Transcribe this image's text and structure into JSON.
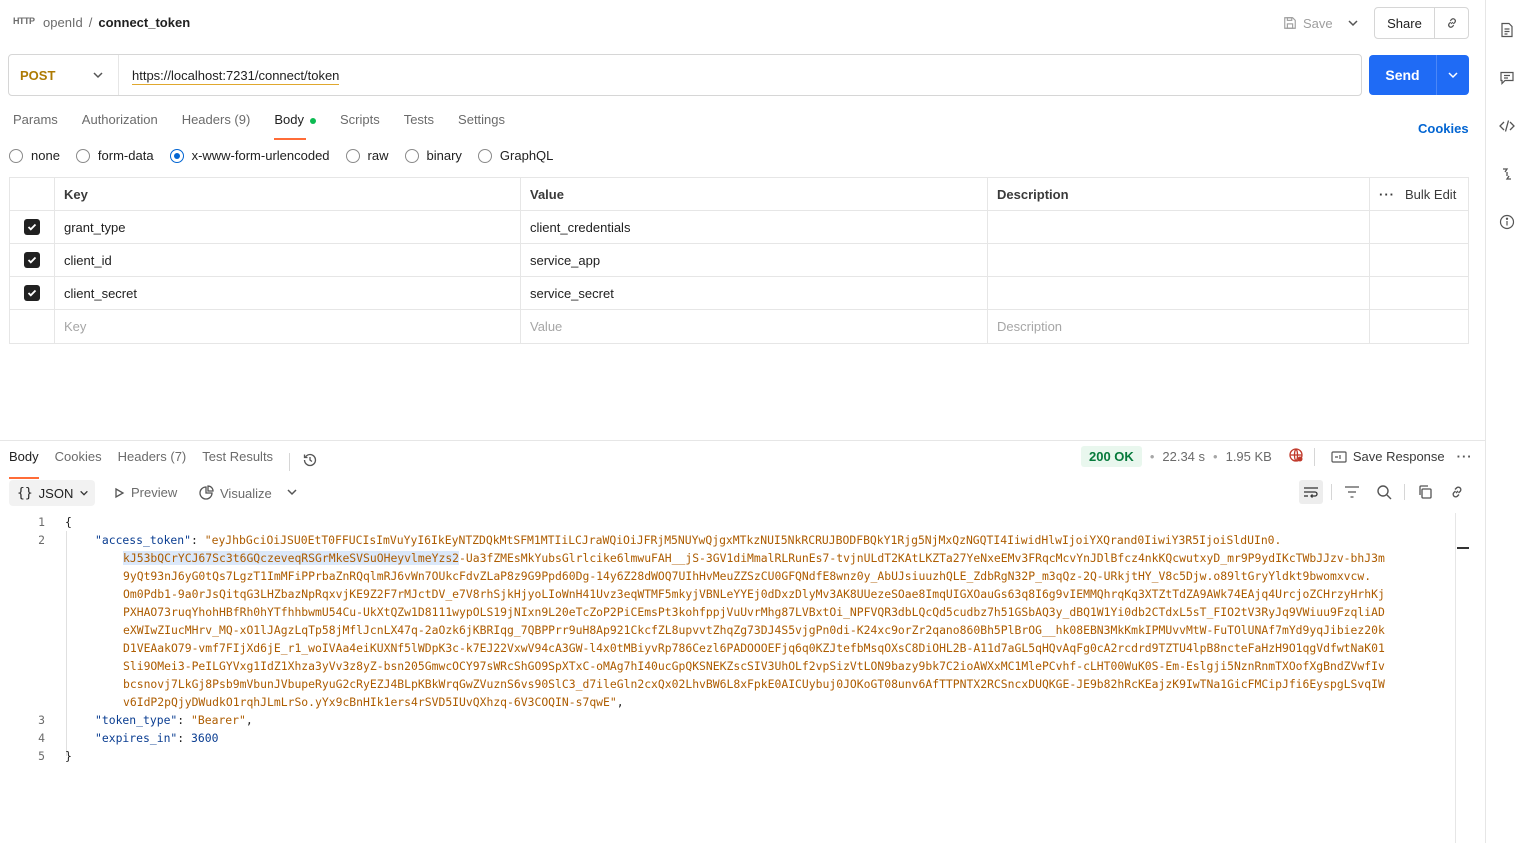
{
  "header": {
    "http_label": "HTTP",
    "crumb_parent": "openId",
    "crumb_sep": "/",
    "crumb_current": "connect_token",
    "save_label": "Save",
    "share_label": "Share"
  },
  "request": {
    "method": "POST",
    "url": "https://localhost:7231/connect/token",
    "send_label": "Send",
    "tabs": [
      {
        "label": "Params"
      },
      {
        "label": "Authorization"
      },
      {
        "label": "Headers (9)"
      },
      {
        "label": "Body"
      },
      {
        "label": "Scripts"
      },
      {
        "label": "Tests"
      },
      {
        "label": "Settings"
      }
    ],
    "cookies_label": "Cookies",
    "body_types": [
      {
        "label": "none",
        "selected": false
      },
      {
        "label": "form-data",
        "selected": false
      },
      {
        "label": "x-www-form-urlencoded",
        "selected": true
      },
      {
        "label": "raw",
        "selected": false
      },
      {
        "label": "binary",
        "selected": false
      },
      {
        "label": "GraphQL",
        "selected": false
      }
    ],
    "table": {
      "headers": {
        "key": "Key",
        "value": "Value",
        "description": "Description",
        "bulk_edit": "Bulk Edit"
      },
      "rows": [
        {
          "key": "grant_type",
          "value": "client_credentials",
          "checked": true
        },
        {
          "key": "client_id",
          "value": "service_app",
          "checked": true
        },
        {
          "key": "client_secret",
          "value": "service_secret",
          "checked": true
        }
      ],
      "placeholders": {
        "key": "Key",
        "value": "Value",
        "description": "Description"
      }
    }
  },
  "response": {
    "tabs": [
      {
        "label": "Body"
      },
      {
        "label": "Cookies"
      },
      {
        "label": "Headers (7)"
      },
      {
        "label": "Test Results"
      }
    ],
    "status": "200 OK",
    "time": "22.34 s",
    "size": "1.95 KB",
    "save_response_label": "Save Response",
    "format_label": "JSON",
    "preview_label": "Preview",
    "visualize_label": "Visualize",
    "code": {
      "line_numbers": [
        "1",
        "2",
        "3",
        "4",
        "5"
      ],
      "open_brace": "{",
      "close_brace": "}",
      "access_token_key": "\"access_token\"",
      "token_line_1": "\"eyJhbGciOiJSU0EtT0FFUCIsImVuYyI6IkEyNTZDQkMtSFM1MTIiLCJraWQiOiJFRjM5NUYwQjgxMTkzNUI5NkRCRUJBODFBQkY1Rjg5NjMxQzNGQTI4IiwidHlwIjoiYXQrand0IiwiY3R5IjoiSldUIn0.",
      "token_line_2_hl": "kJ53bQCrYCJ67Sc3t6GQczeveqRSGrMkeSVSuOHeyvlmeYzs2",
      "token_line_2_rest": "-Ua3fZMEsMkYubsGlrlcike6lmwuFAH__jS-3GV1diMmalRLRunEs7-tvjnULdT2KAtLKZTa27YeNxeEMv3FRqcMcvYnJDlBfcz4nkKQcwutxyD_mr9P9ydIKcTWbJJzv-bhJ3m",
      "token_line_3": "9yQt93nJ6yG0tQs7LgzT1ImMFiPPrbaZnRQqlmRJ6vWn7OUkcFdvZLaP8z9G9Ppd60Dg-14y6Z28dWOQ7UIhHvMeuZZSzCU0GFQNdfE8wnz0y_AbUJsiuuzhQLE_ZdbRgN32P_m3qQz-2Q-URkjtHY_V8c5Djw.o89ltGryYldkt9bwomxvcw.",
      "token_line_4": "Om0Pdb1-9a0rJsQitqG3LHZbazNpRqxvjKE9Z2F7rMJctDV_e7V8rhSjkHjyoLIoWnH41Uvz3eqWTMF5mkyjVBNLeYYEj0dDxzDlyMv3AK8UUezeSOae8ImqUIGXOauGs63q8I6g9vIEMMQhrqKq3XTZtTdZA9AWk74EAjq4UrcjoZCHrzyHrhKj",
      "token_line_5": "PXHAO73ruqYhohHBfRh0hYTfhhbwmU54Cu-UkXtQZw1D8111wypOLS19jNIxn9L20eTcZoP2PiCEmsPt3kohfppjVuUvrMhg87LVBxtOi_NPFVQR3dbLQcQd5cudbz7h51GSbAQ3y_dBQ1W1Yi0db2CTdxL5sT_FIO2tV3RyJq9VWiuu9FzqliAD",
      "token_line_6": "eXWIwZIucMHrv_MQ-xO1lJAgzLqTp58jMflJcnLX47q-2aOzk6jKBRIqg_7QBPPrr9uH8Ap921CkcfZL8upvvtZhqZg73DJ4S5vjgPn0di-K24xc9orZr2qano860Bh5PlBrOG__hk08EBN3MkKmkIPMUvvMtW-FuTOlUNAf7mYd9yqJibiez20k",
      "token_line_7": "D1VEAakO79-vmf7FIjXd6jE_r1_woIVAa4eiKUXNf5lWDpK3c-k7EJ22VxwV94cA3GW-l4x0tMBiyvRp786Cezl6PADOOOEFjq6q0KZJtefbMsqOXsC8DiOHL2B-A11d7aGL5qHQvAqFg0cA2rcdrd9TZTU4lpB8ncteFaHzH9O1qgVdfwtNaK01",
      "token_line_8": "Sli9OMei3-PeILGYVxg1IdZ1Xhza3yVv3z8yZ-bsn205GmwcOCY97sWRcShGO9SpXTxC-oMAg7hI40ucGpQKSNEKZscSIV3UhOLf2vpSizVtLON9bazy9bk7C2ioAWXxMC1MlePCvhf-cLHT00WuK0S-Em-Eslgji5NznRnmTXOofXgBndZVwfIv",
      "token_line_9": "bcsnovj7LkGj8Psb9mVbunJVbupeRyuG2cRyEZJ4BLpKBkWrqGwZVuznS6vs90SlC3_d7ileGln2cxQx02LhvBW6L8xFpkE0AICUybuj0JOKoGT08unv6AfTTPNTX2RCSncxDUQKGE-JE9b82hRcKEajzK9IwTNa1GicFMCipJfi6EyspgLSvqIW",
      "token_line_10": "v6IdP2pQjyDWudkO1rqhJLmLrSo.yYx9cBnHIk1ers4rSVD5IUvQXhzq-6V3COQIN-s7qwE\"",
      "token_type_key": "\"token_type\"",
      "token_type_value": "\"Bearer\"",
      "expires_in_key": "\"expires_in\"",
      "expires_in_value": "3600"
    }
  },
  "colors": {
    "accent_tab": "#ff6c37",
    "send_button": "#1f6bf5",
    "method_post": "#ad7a03",
    "status_ok": "#067a3b"
  }
}
